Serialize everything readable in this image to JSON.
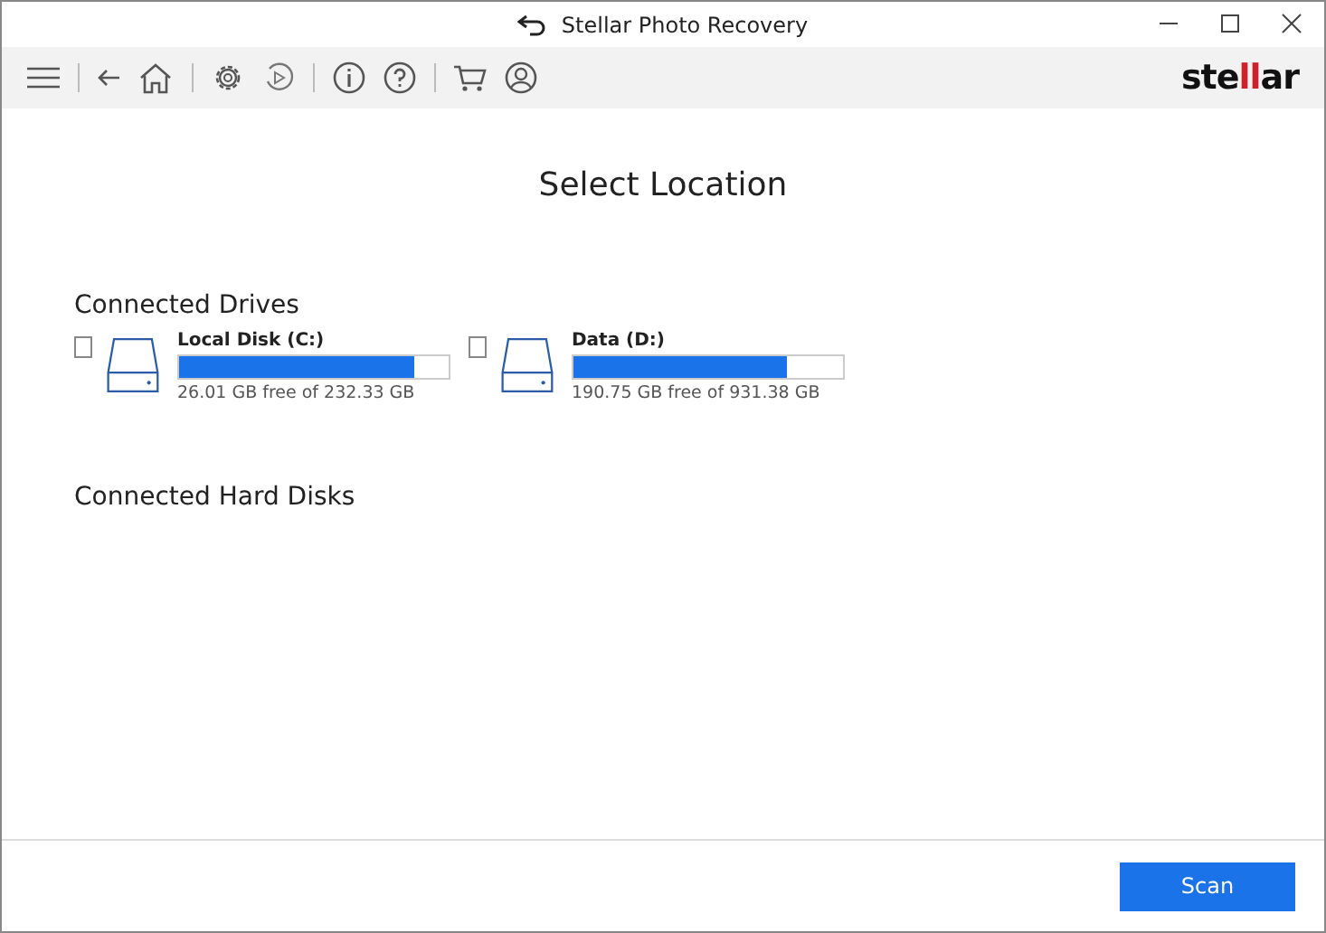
{
  "window": {
    "title": "Stellar Photo Recovery"
  },
  "logo": {
    "parts": [
      {
        "text": "ste",
        "accent": false
      },
      {
        "text": "ll",
        "accent": true
      },
      {
        "text": "ar",
        "accent": false
      }
    ]
  },
  "heading": "Select Location",
  "sections": [
    {
      "title": "Connected Drives",
      "drives": [
        {
          "name": "Local Disk (C:)",
          "checked": false,
          "level": 0.87,
          "info": "26.01 GB free of 232.33 GB"
        },
        {
          "name": "Data (D:)",
          "checked": false,
          "level": 0.79,
          "info": "190.75 GB free of 931.38 GB"
        }
      ]
    },
    {
      "title": "Connected Hard Disks"
    }
  ],
  "buttons": [
    {
      "label": "Scan"
    }
  ]
}
